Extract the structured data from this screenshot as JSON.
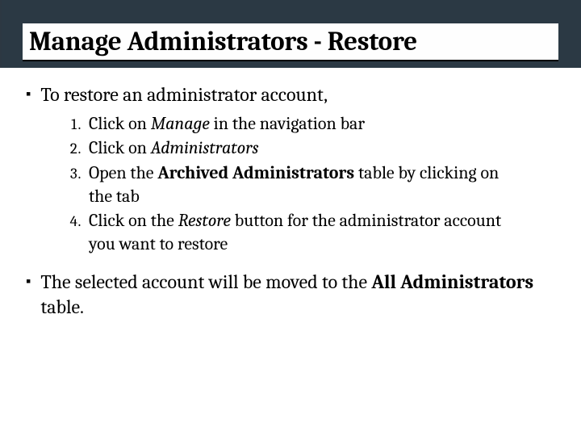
{
  "title": "Manage Administrators - Restore",
  "bullet1": "To restore an administrator account,",
  "steps": {
    "s1a": "Click on ",
    "s1b": "Manage",
    "s1c": " in the navigation bar",
    "s2a": "Click on ",
    "s2b": "Administrators",
    "s3a": "Open the ",
    "s3b": "Archived Administrators",
    "s3c": " table by clicking on the tab",
    "s4a": "Click on the ",
    "s4b": "Restore",
    "s4c": " button for the administrator account you want to restore"
  },
  "bullet2a": "The selected account will be moved to the ",
  "bullet2b": "All Administrators",
  "bullet2c": " table."
}
